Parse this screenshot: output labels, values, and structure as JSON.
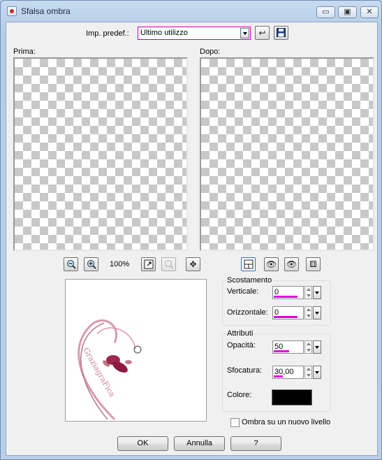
{
  "window": {
    "title": "Sfalsa ombra"
  },
  "titlebar_buttons": {
    "minimize": "▭",
    "maximize": "▣",
    "close": "✕"
  },
  "preset": {
    "label": "Imp. predef.:",
    "value": "Ultimo utilizzo"
  },
  "previews": {
    "before_label": "Prima:",
    "after_label": "Dopo:"
  },
  "zoom": {
    "level": "100%"
  },
  "offset_group": {
    "title": "Scostamento",
    "vertical": {
      "label": "Verticale:",
      "value": "0"
    },
    "horizontal": {
      "label": "Orizzontale:",
      "value": "0"
    }
  },
  "attributes_group": {
    "title": "Attributi",
    "opacity": {
      "label": "Opacità:",
      "value": "50",
      "level": 0.5
    },
    "blur": {
      "label": "Sfocatura:",
      "value": "30,00",
      "level": 0.3
    },
    "color": {
      "label": "Colore:",
      "value": "#000000"
    }
  },
  "new_layer_checkbox": {
    "label": "Ombra su un nuovo livello",
    "checked": false
  },
  "buttons": {
    "ok": "OK",
    "cancel": "Annulla",
    "help": "?"
  },
  "watermark": {
    "text": "GraziagraFica"
  },
  "colors": {
    "accent_magenta": "#e000e0",
    "title_bar": "#b9cfe7",
    "dialog_bg": "#f0f0f0"
  }
}
